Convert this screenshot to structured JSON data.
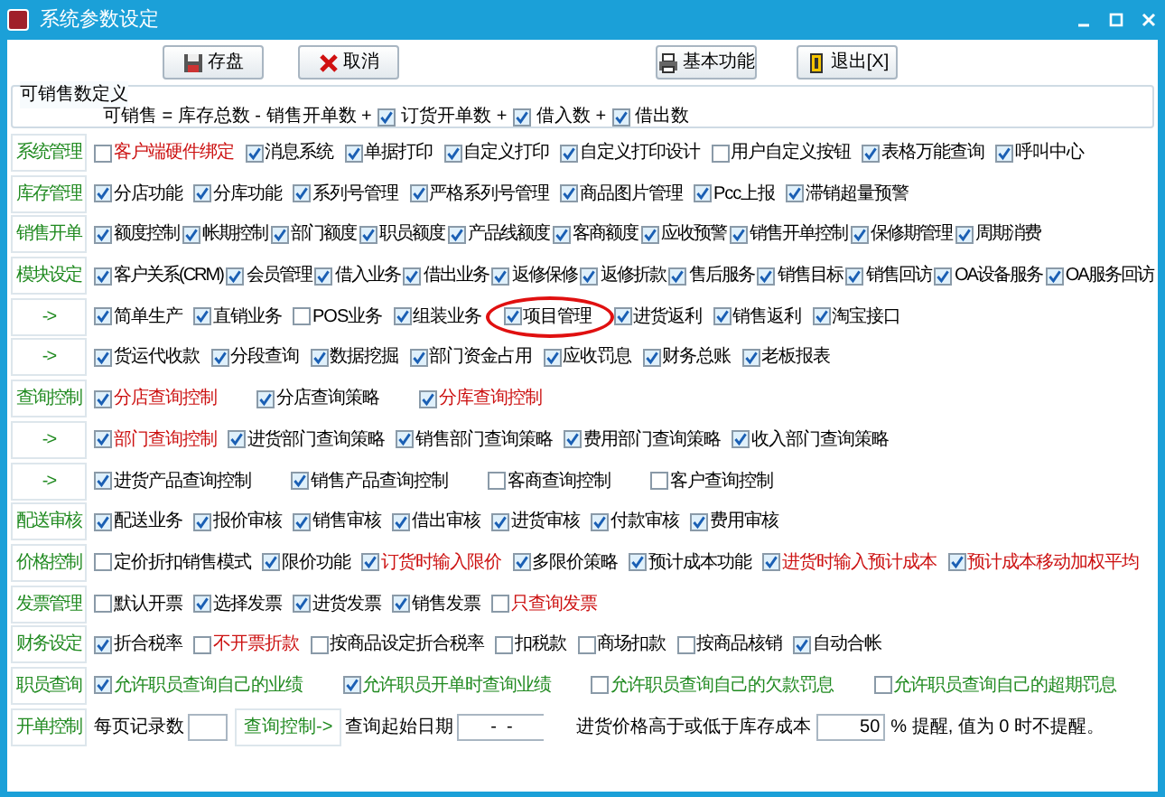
{
  "window": {
    "title": "系统参数设定"
  },
  "toolbar": [
    {
      "label": "存盘"
    },
    {
      "label": "取消"
    },
    {
      "label": "基本功能"
    },
    {
      "label": "退出[X]"
    }
  ],
  "formula": {
    "title": "可销售数定义",
    "prefix": "可销售 = 库存总数 - 销售开单数 +",
    "items": [
      {
        "label": "订货开单数",
        "checked": true,
        "operator": "+"
      },
      {
        "label": "借入数",
        "checked": true,
        "operator": "+"
      },
      {
        "label": "借出数",
        "checked": true
      }
    ]
  },
  "sections": [
    {
      "kind": "checks",
      "label": "系统管理",
      "items": [
        {
          "label": "客户端硬件绑定",
          "checked": false,
          "color": "#cc1111"
        },
        {
          "label": "消息系统",
          "checked": true
        },
        {
          "label": "单据打印",
          "checked": true
        },
        {
          "label": "自定义打印",
          "checked": true
        },
        {
          "label": "自定义打印设计",
          "checked": true
        },
        {
          "label": "用户自定义按钮",
          "checked": false
        },
        {
          "label": "表格万能查询",
          "checked": true
        },
        {
          "label": "呼叫中心",
          "checked": true
        }
      ]
    },
    {
      "kind": "checks",
      "label": "库存管理",
      "items": [
        {
          "label": "分店功能",
          "checked": true
        },
        {
          "label": "分库功能",
          "checked": true
        },
        {
          "label": "系列号管理",
          "checked": true
        },
        {
          "label": "严格系列号管理",
          "checked": true
        },
        {
          "label": "商品图片管理",
          "checked": true
        },
        {
          "label": "Pcc上报",
          "checked": true
        },
        {
          "label": "滞销超量预警",
          "checked": true
        }
      ]
    },
    {
      "kind": "checks",
      "label": "销售开单",
      "items": [
        {
          "label": "额度控制",
          "checked": true
        },
        {
          "label": "帐期控制",
          "checked": true
        },
        {
          "label": "部门额度",
          "checked": true
        },
        {
          "label": "职员额度",
          "checked": true
        },
        {
          "label": "产品线额度",
          "checked": true
        },
        {
          "label": "客商额度",
          "checked": true
        },
        {
          "label": "应收预警",
          "checked": true
        },
        {
          "label": "销售开单控制",
          "checked": true
        },
        {
          "label": "保修期管理",
          "checked": true
        },
        {
          "label": "周期消费",
          "checked": true
        }
      ]
    },
    {
      "kind": "checks",
      "label": "模块设定",
      "items": [
        {
          "label": "客户关系(CRM)",
          "checked": true
        },
        {
          "label": "会员管理",
          "checked": true
        },
        {
          "label": "借入业务",
          "checked": true
        },
        {
          "label": "借出业务",
          "checked": true
        },
        {
          "label": "返修保修",
          "checked": true
        },
        {
          "label": "返修折款",
          "checked": true
        },
        {
          "label": "售后服务",
          "checked": true
        },
        {
          "label": "销售目标",
          "checked": true
        },
        {
          "label": "销售回访",
          "checked": true
        },
        {
          "label": "OA设备服务",
          "checked": true
        },
        {
          "label": "OA服务回访",
          "checked": true
        }
      ]
    },
    {
      "kind": "checks",
      "label": "->",
      "items": [
        {
          "label": "简单生产",
          "checked": true
        },
        {
          "label": "直销业务",
          "checked": true
        },
        {
          "label": "POS业务",
          "checked": false
        },
        {
          "label": "组装业务",
          "checked": true
        },
        {
          "label": "项目管理",
          "checked": true,
          "circled": true
        },
        {
          "label": "进货返利",
          "checked": true
        },
        {
          "label": "销售返利",
          "checked": true
        },
        {
          "label": "淘宝接口",
          "checked": true
        }
      ]
    },
    {
      "kind": "checks",
      "label": "->",
      "items": [
        {
          "label": "货运代收款",
          "checked": true
        },
        {
          "label": "分段查询",
          "checked": true
        },
        {
          "label": "数据挖掘",
          "checked": true
        },
        {
          "label": "部门资金占用",
          "checked": true
        },
        {
          "label": "应收罚息",
          "checked": true
        },
        {
          "label": "财务总账",
          "checked": true
        },
        {
          "label": "老板报表",
          "checked": true
        }
      ]
    },
    {
      "kind": "checks",
      "label": "查询控制",
      "items": [
        {
          "label": "分店查询控制",
          "checked": true,
          "color": "#cc1111"
        },
        {
          "label": "分店查询策略",
          "checked": true
        },
        {
          "label": "分库查询控制",
          "checked": true,
          "color": "#cc1111"
        }
      ]
    },
    {
      "kind": "checks",
      "label": "->",
      "items": [
        {
          "label": "部门查询控制",
          "checked": true,
          "color": "#cc1111"
        },
        {
          "label": "进货部门查询策略",
          "checked": true
        },
        {
          "label": "销售部门查询策略",
          "checked": true
        },
        {
          "label": "费用部门查询策略",
          "checked": true
        },
        {
          "label": "收入部门查询策略",
          "checked": true
        }
      ]
    },
    {
      "kind": "checks",
      "label": "->",
      "items": [
        {
          "label": "进货产品查询控制",
          "checked": true
        },
        {
          "label": "销售产品查询控制",
          "checked": true
        },
        {
          "label": "客商查询控制",
          "checked": false
        },
        {
          "label": "客户查询控制",
          "checked": false
        }
      ]
    },
    {
      "kind": "checks",
      "label": "配送审核",
      "items": [
        {
          "label": "配送业务",
          "checked": true
        },
        {
          "label": "报价审核",
          "checked": true
        },
        {
          "label": "销售审核",
          "checked": true
        },
        {
          "label": "借出审核",
          "checked": true
        },
        {
          "label": "进货审核",
          "checked": true
        },
        {
          "label": "付款审核",
          "checked": true
        },
        {
          "label": "费用审核",
          "checked": true
        }
      ]
    },
    {
      "kind": "checks",
      "label": "价格控制",
      "items": [
        {
          "label": "定价折扣销售模式",
          "checked": false
        },
        {
          "label": "限价功能",
          "checked": true
        },
        {
          "label": "订货时输入限价",
          "checked": true,
          "color": "#cc1111"
        },
        {
          "label": "多限价策略",
          "checked": true
        },
        {
          "label": "预计成本功能",
          "checked": true
        },
        {
          "label": "进货时输入预计成本",
          "checked": true,
          "color": "#cc1111"
        },
        {
          "label": "预计成本移动加权平均",
          "checked": true,
          "color": "#cc1111"
        }
      ]
    },
    {
      "kind": "checks",
      "label": "发票管理",
      "items": [
        {
          "label": "默认开票",
          "checked": false
        },
        {
          "label": "选择发票",
          "checked": true
        },
        {
          "label": "进货发票",
          "checked": true
        },
        {
          "label": "销售发票",
          "checked": true
        },
        {
          "label": "只查询发票",
          "checked": false,
          "color": "#cc1111"
        }
      ]
    },
    {
      "kind": "checks",
      "label": "财务设定",
      "items": [
        {
          "label": "折合税率",
          "checked": true
        },
        {
          "label": "不开票折款",
          "checked": false,
          "color": "#cc1111"
        },
        {
          "label": "按商品设定折合税率",
          "checked": false
        },
        {
          "label": "扣税款",
          "checked": false
        },
        {
          "label": "商场扣款",
          "checked": false
        },
        {
          "label": "按商品核销",
          "checked": false
        },
        {
          "label": "自动合帐",
          "checked": true
        }
      ]
    },
    {
      "kind": "checks",
      "label": "职员查询",
      "items": [
        {
          "label": "允许职员查询自己的业绩",
          "checked": true,
          "color": "#228b22"
        },
        {
          "label": "允许职员开单时查询业绩",
          "checked": true,
          "color": "#228b22"
        },
        {
          "label": "允许职员查询自己的欠款罚息",
          "checked": false,
          "color": "#228b22"
        },
        {
          "label": "允许职员查询自己的超期罚息",
          "checked": false,
          "color": "#228b22"
        }
      ]
    },
    {
      "kind": "controls",
      "label": "开单控制",
      "page_size_label": "每页记录数",
      "query_button": "查询控制->",
      "start_date_label": "查询起始日期",
      "start_date": "-  -",
      "cost_label": "进货价格高于或低于库存成本",
      "cost_percent": "50",
      "cost_note": "% 提醒, 值为 0 时不提醒。"
    }
  ]
}
